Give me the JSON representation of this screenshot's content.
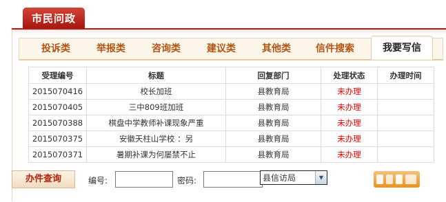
{
  "header": {
    "title": "市民问政"
  },
  "tabs": [
    {
      "label": "投诉类",
      "active": false
    },
    {
      "label": "举报类",
      "active": false
    },
    {
      "label": "咨询类",
      "active": false
    },
    {
      "label": "建议类",
      "active": false
    },
    {
      "label": "其他类",
      "active": false
    },
    {
      "label": "信件搜索",
      "active": false
    },
    {
      "label": "我要写信",
      "active": true
    }
  ],
  "table": {
    "columns": [
      "受理编号",
      "标题",
      "回复部门",
      "处理状态",
      "办理时间"
    ],
    "rows": [
      {
        "id": "2015070416",
        "title": "校长加班",
        "dept": "县教育局",
        "status": "未办理",
        "time": ""
      },
      {
        "id": "2015070405",
        "title": "三中809班加班",
        "dept": "县教育局",
        "status": "未办理",
        "time": ""
      },
      {
        "id": "2015070388",
        "title": "棋盘中学教师补课现象严重",
        "dept": "县教育局",
        "status": "未办理",
        "time": ""
      },
      {
        "id": "2015070375",
        "title": "安徽天柱山学校 ：另",
        "dept": "县教育局",
        "status": "未办理",
        "time": ""
      },
      {
        "id": "2015070371",
        "title": "暑期补课为何屡禁不止",
        "dept": "县教育局",
        "status": "未办理",
        "time": ""
      }
    ],
    "status_color": "#e60000"
  },
  "query": {
    "button_label": "办件查询",
    "number_label": "编号:",
    "number_value": "",
    "password_label": "密码:",
    "password_value": "",
    "dept_selected": "县信访局"
  },
  "colors": {
    "accent": "#b01c12",
    "tab_text": "#b35412"
  }
}
